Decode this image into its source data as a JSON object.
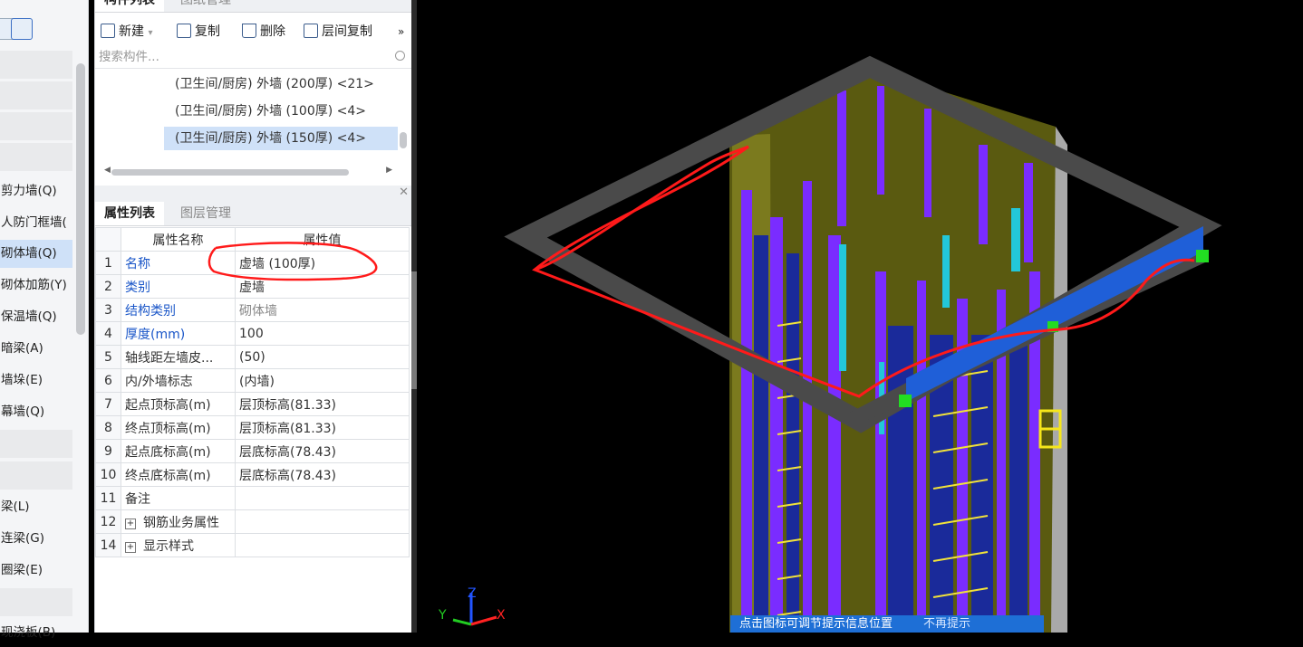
{
  "left_panel": {
    "items": [
      "剪力墙(Q)",
      "人防门框墙(",
      "砌体墙(Q)",
      "砌体加筋(Y)",
      "保温墙(Q)",
      "暗梁(A)",
      "墙垛(E)",
      "幕墙(Q)",
      "梁(L)",
      "连梁(G)",
      "圈梁(E)",
      "现浇板(B)"
    ]
  },
  "component_list": {
    "tabs": [
      "构件列表",
      "图纸管理"
    ],
    "toolbar": {
      "new_label": "新建",
      "copy_label": "复制",
      "delete_label": "删除",
      "floor_copy_label": "层间复制",
      "more": "»"
    },
    "search_placeholder": "搜索构件...",
    "items": [
      "(卫生间/厨房) 外墙 (200厚) <21>",
      "(卫生间/厨房) 外墙 (100厚) <4>",
      "(卫生间/厨房) 外墙 (150厚) <4>"
    ],
    "selected_index": 2
  },
  "property_panel": {
    "tabs": [
      "属性列表",
      "图层管理"
    ],
    "header": {
      "name": "属性名称",
      "value": "属性值"
    },
    "rows": [
      {
        "no": "1",
        "name": "名称",
        "value": "虚墙 (100厚)"
      },
      {
        "no": "2",
        "name": "类别",
        "value": "虚墙"
      },
      {
        "no": "3",
        "name": "结构类别",
        "value": "砌体墙"
      },
      {
        "no": "4",
        "name": "厚度(mm)",
        "value": "100"
      },
      {
        "no": "5",
        "name": "轴线距左墙皮...",
        "value": "(50)"
      },
      {
        "no": "6",
        "name": "内/外墙标志",
        "value": "(内墙)"
      },
      {
        "no": "7",
        "name": "起点顶标高(m)",
        "value": "层顶标高(81.33)"
      },
      {
        "no": "8",
        "name": "终点顶标高(m)",
        "value": "层顶标高(81.33)"
      },
      {
        "no": "9",
        "name": "起点底标高(m)",
        "value": "层底标高(78.43)"
      },
      {
        "no": "10",
        "name": "终点底标高(m)",
        "value": "层底标高(78.43)"
      },
      {
        "no": "11",
        "name": "备注",
        "value": ""
      },
      {
        "no": "12",
        "name": "钢筋业务属性",
        "value": ""
      },
      {
        "no": "14",
        "name": "显示样式",
        "value": ""
      }
    ]
  },
  "viewport": {
    "axis_labels": {
      "x": "X",
      "y": "Y",
      "z": "Z"
    },
    "hint_text": "点击图标可调节提示信息位置",
    "hint_dismiss": "不再提示"
  },
  "colors": {
    "selection": "#cfe1f8",
    "link_blue": "#1a56c8",
    "selected_wall": "#1f5fd8",
    "annotation": "#ff1a1a",
    "grip_green": "#22dd22",
    "column_purple": "#7a2cff",
    "wall_olive": "#7b7a1e"
  }
}
